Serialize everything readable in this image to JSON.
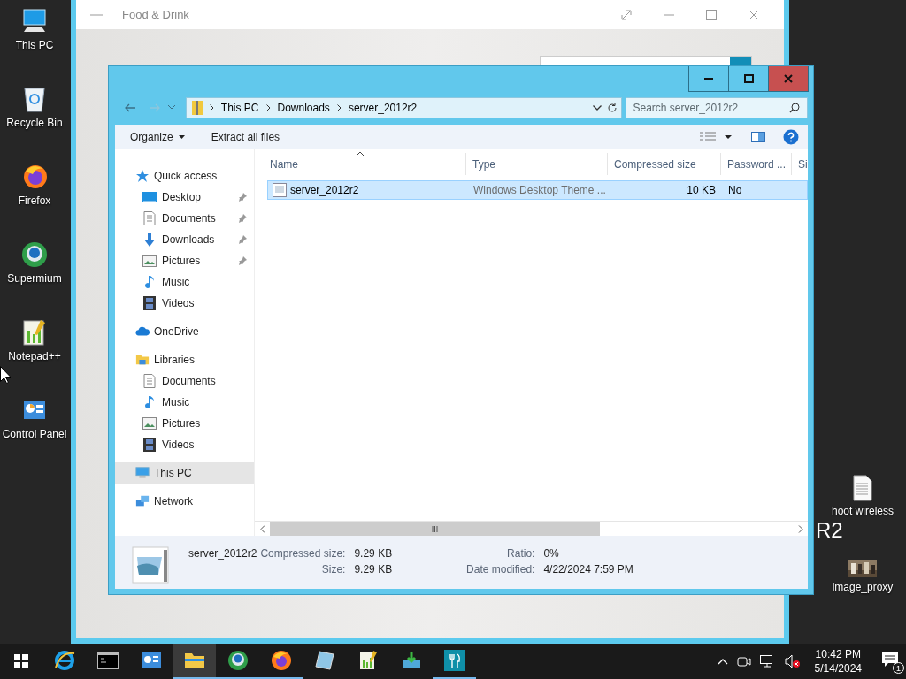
{
  "desktop": {
    "icons": [
      {
        "label": "This PC"
      },
      {
        "label": "Recycle Bin"
      },
      {
        "label": "Firefox"
      },
      {
        "label": "Supermium"
      },
      {
        "label": "Notepad++"
      },
      {
        "label": "Control Panel"
      },
      {
        "label": "hoot wireless"
      },
      {
        "label": "image_proxy"
      }
    ],
    "wallpaper_text": "R2"
  },
  "background_window": {
    "title": "Food & Drink"
  },
  "explorer": {
    "path": [
      "This PC",
      "Downloads",
      "server_2012r2"
    ],
    "search": {
      "placeholder": "Search server_2012r2"
    },
    "toolbar": [
      {
        "label": "Organize",
        "kind": "menu"
      },
      {
        "label": "Extract all files",
        "kind": "button"
      }
    ],
    "navigation": [
      {
        "label": "Quick access",
        "selected": false,
        "children": [
          {
            "label": "Desktop",
            "pinned": true,
            "selected": false
          },
          {
            "label": "Documents",
            "pinned": true,
            "selected": false
          },
          {
            "label": "Downloads",
            "pinned": true,
            "selected": false
          },
          {
            "label": "Pictures",
            "pinned": true,
            "selected": false
          },
          {
            "label": "Music",
            "pinned": false,
            "selected": false
          },
          {
            "label": "Videos",
            "pinned": false,
            "selected": false
          }
        ]
      },
      {
        "label": "OneDrive",
        "selected": false
      },
      {
        "label": "Libraries",
        "selected": false,
        "children": [
          {
            "label": "Documents",
            "pinned": false,
            "selected": false
          },
          {
            "label": "Music",
            "pinned": false,
            "selected": false
          },
          {
            "label": "Pictures",
            "pinned": false,
            "selected": false
          },
          {
            "label": "Videos",
            "pinned": false,
            "selected": false
          }
        ]
      },
      {
        "label": "This PC",
        "selected": true
      },
      {
        "label": "Network",
        "selected": false
      }
    ],
    "columns": [
      {
        "label": "Name",
        "sorted": true
      },
      {
        "label": "Type",
        "sorted": false
      },
      {
        "label": "Compressed size",
        "sorted": false
      },
      {
        "label": "Password ...",
        "sorted": false
      },
      {
        "label": "Si",
        "sorted": false
      }
    ],
    "rows": [
      {
        "cells": [
          "server_2012r2",
          "Windows Desktop Theme ...",
          "10 KB",
          "No"
        ],
        "selected": true
      }
    ],
    "details": {
      "name": "server_2012r2",
      "fields": [
        {
          "label": "Compressed size:",
          "value": "9.29 KB"
        },
        {
          "label": "Size:",
          "value": "9.29 KB"
        },
        {
          "label": "Ratio:",
          "value": "0%"
        },
        {
          "label": "Date modified:",
          "value": "4/22/2024 7:59 PM"
        }
      ]
    }
  },
  "taskbar": {
    "apps": [
      {
        "running": false,
        "active": false
      },
      {
        "running": false,
        "active": false
      },
      {
        "running": false,
        "active": false
      },
      {
        "running": true,
        "active": true
      },
      {
        "running": true,
        "active": false
      },
      {
        "running": true,
        "active": false
      },
      {
        "running": false,
        "active": false
      },
      {
        "running": false,
        "active": false
      },
      {
        "running": false,
        "active": false
      },
      {
        "running": true,
        "active": false
      }
    ],
    "clock": {
      "time": "10:42 PM",
      "date": "5/14/2024"
    },
    "notifications": "1"
  }
}
